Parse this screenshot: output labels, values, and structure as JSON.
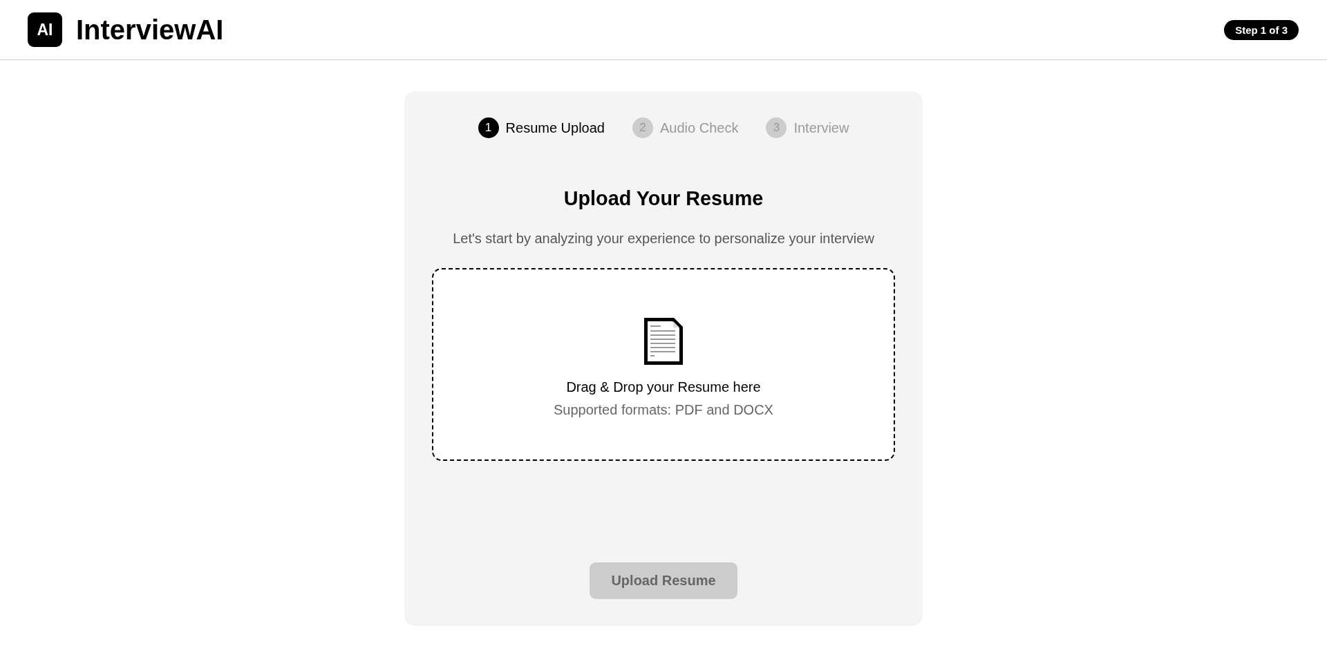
{
  "header": {
    "logo": "AI",
    "title": "InterviewAI",
    "step_badge": "Step 1 of 3"
  },
  "steps": [
    {
      "number": "1",
      "label": "Resume Upload",
      "current": true
    },
    {
      "number": "2",
      "label": "Audio Check",
      "current": false
    },
    {
      "number": "3",
      "label": "Interview",
      "current": false
    }
  ],
  "upload": {
    "title": "Upload Your Resume",
    "subtitle": "Let's start by analyzing your experience to personalize your interview",
    "dropzone": {
      "prompt": "Drag & Drop your Resume here",
      "hint": "Supported formats: PDF and DOCX"
    },
    "button": {
      "label": "Upload Resume",
      "disabled": true
    }
  }
}
